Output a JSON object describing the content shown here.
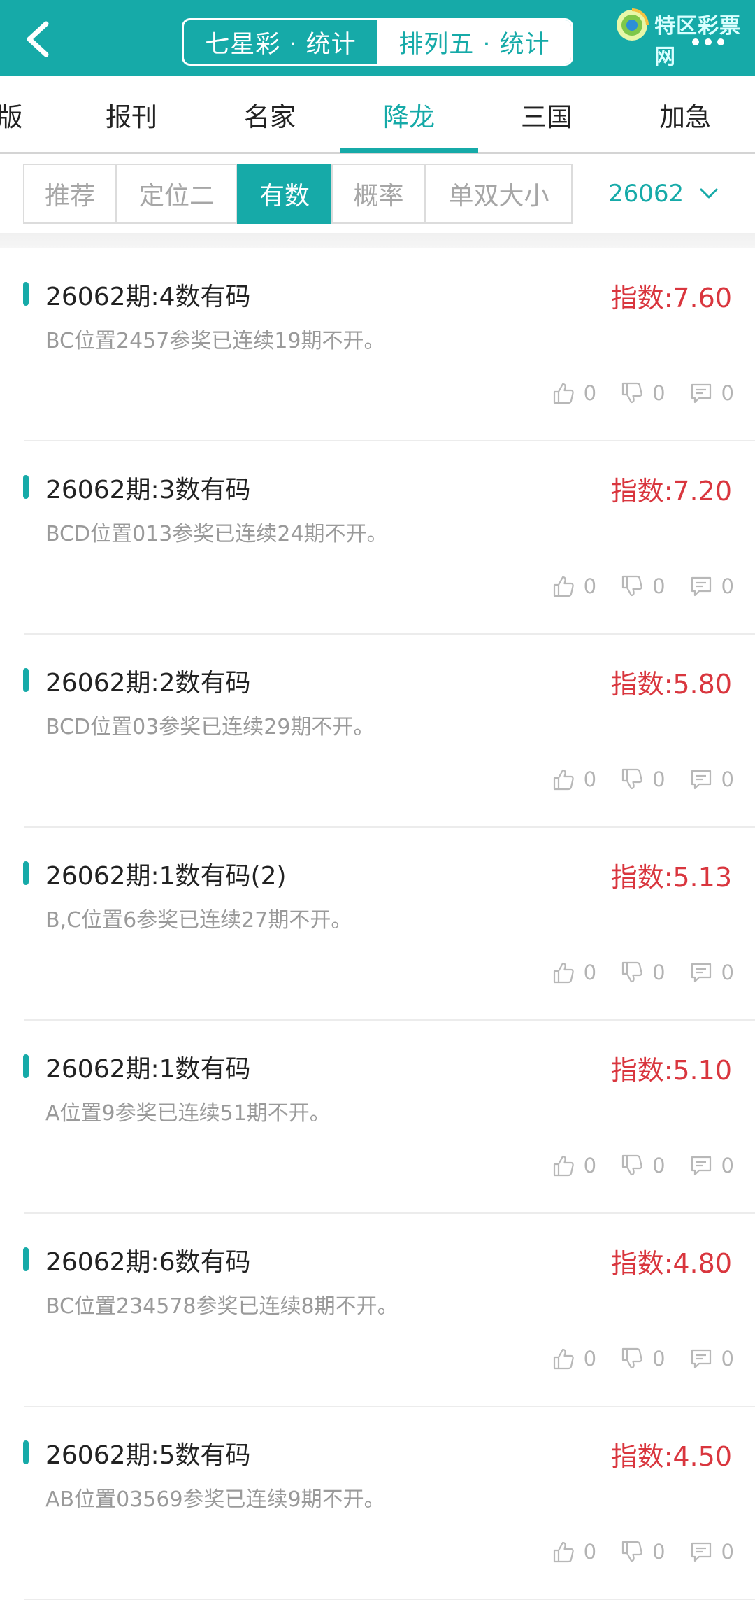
{
  "header": {
    "segments": [
      {
        "label": "七星彩 · 统计",
        "active": false
      },
      {
        "label": "排列五 · 统计",
        "active": true
      }
    ],
    "logo_text": "特区彩票网",
    "accent_color": "#16aaa8"
  },
  "tabs": [
    {
      "label": "版",
      "active": false
    },
    {
      "label": "报刊",
      "active": false
    },
    {
      "label": "名家",
      "active": false
    },
    {
      "label": "降龙",
      "active": true
    },
    {
      "label": "三国",
      "active": false
    },
    {
      "label": "加急",
      "active": false
    }
  ],
  "filters": {
    "chips": [
      {
        "label": "推荐",
        "active": false
      },
      {
        "label": "定位二",
        "active": false
      },
      {
        "label": "有数",
        "active": true
      },
      {
        "label": "概率",
        "active": false
      },
      {
        "label": "单双大小",
        "active": false
      }
    ],
    "period": "26062"
  },
  "items": [
    {
      "title": "26062期:4数有码",
      "index": "指数:7.60",
      "desc": "BC位置2457参奖已连续19期不开。",
      "likes": "0",
      "dislikes": "0",
      "comments": "0"
    },
    {
      "title": "26062期:3数有码",
      "index": "指数:7.20",
      "desc": "BCD位置013参奖已连续24期不开。",
      "likes": "0",
      "dislikes": "0",
      "comments": "0"
    },
    {
      "title": "26062期:2数有码",
      "index": "指数:5.80",
      "desc": "BCD位置03参奖已连续29期不开。",
      "likes": "0",
      "dislikes": "0",
      "comments": "0"
    },
    {
      "title": "26062期:1数有码(2)",
      "index": "指数:5.13",
      "desc": "B,C位置6参奖已连续27期不开。",
      "likes": "0",
      "dislikes": "0",
      "comments": "0"
    },
    {
      "title": "26062期:1数有码",
      "index": "指数:5.10",
      "desc": "A位置9参奖已连续51期不开。",
      "likes": "0",
      "dislikes": "0",
      "comments": "0"
    },
    {
      "title": "26062期:6数有码",
      "index": "指数:4.80",
      "desc": "BC位置234578参奖已连续8期不开。",
      "likes": "0",
      "dislikes": "0",
      "comments": "0"
    },
    {
      "title": "26062期:5数有码",
      "index": "指数:4.50",
      "desc": "AB位置03569参奖已连续9期不开。",
      "likes": "0",
      "dislikes": "0",
      "comments": "0"
    }
  ]
}
